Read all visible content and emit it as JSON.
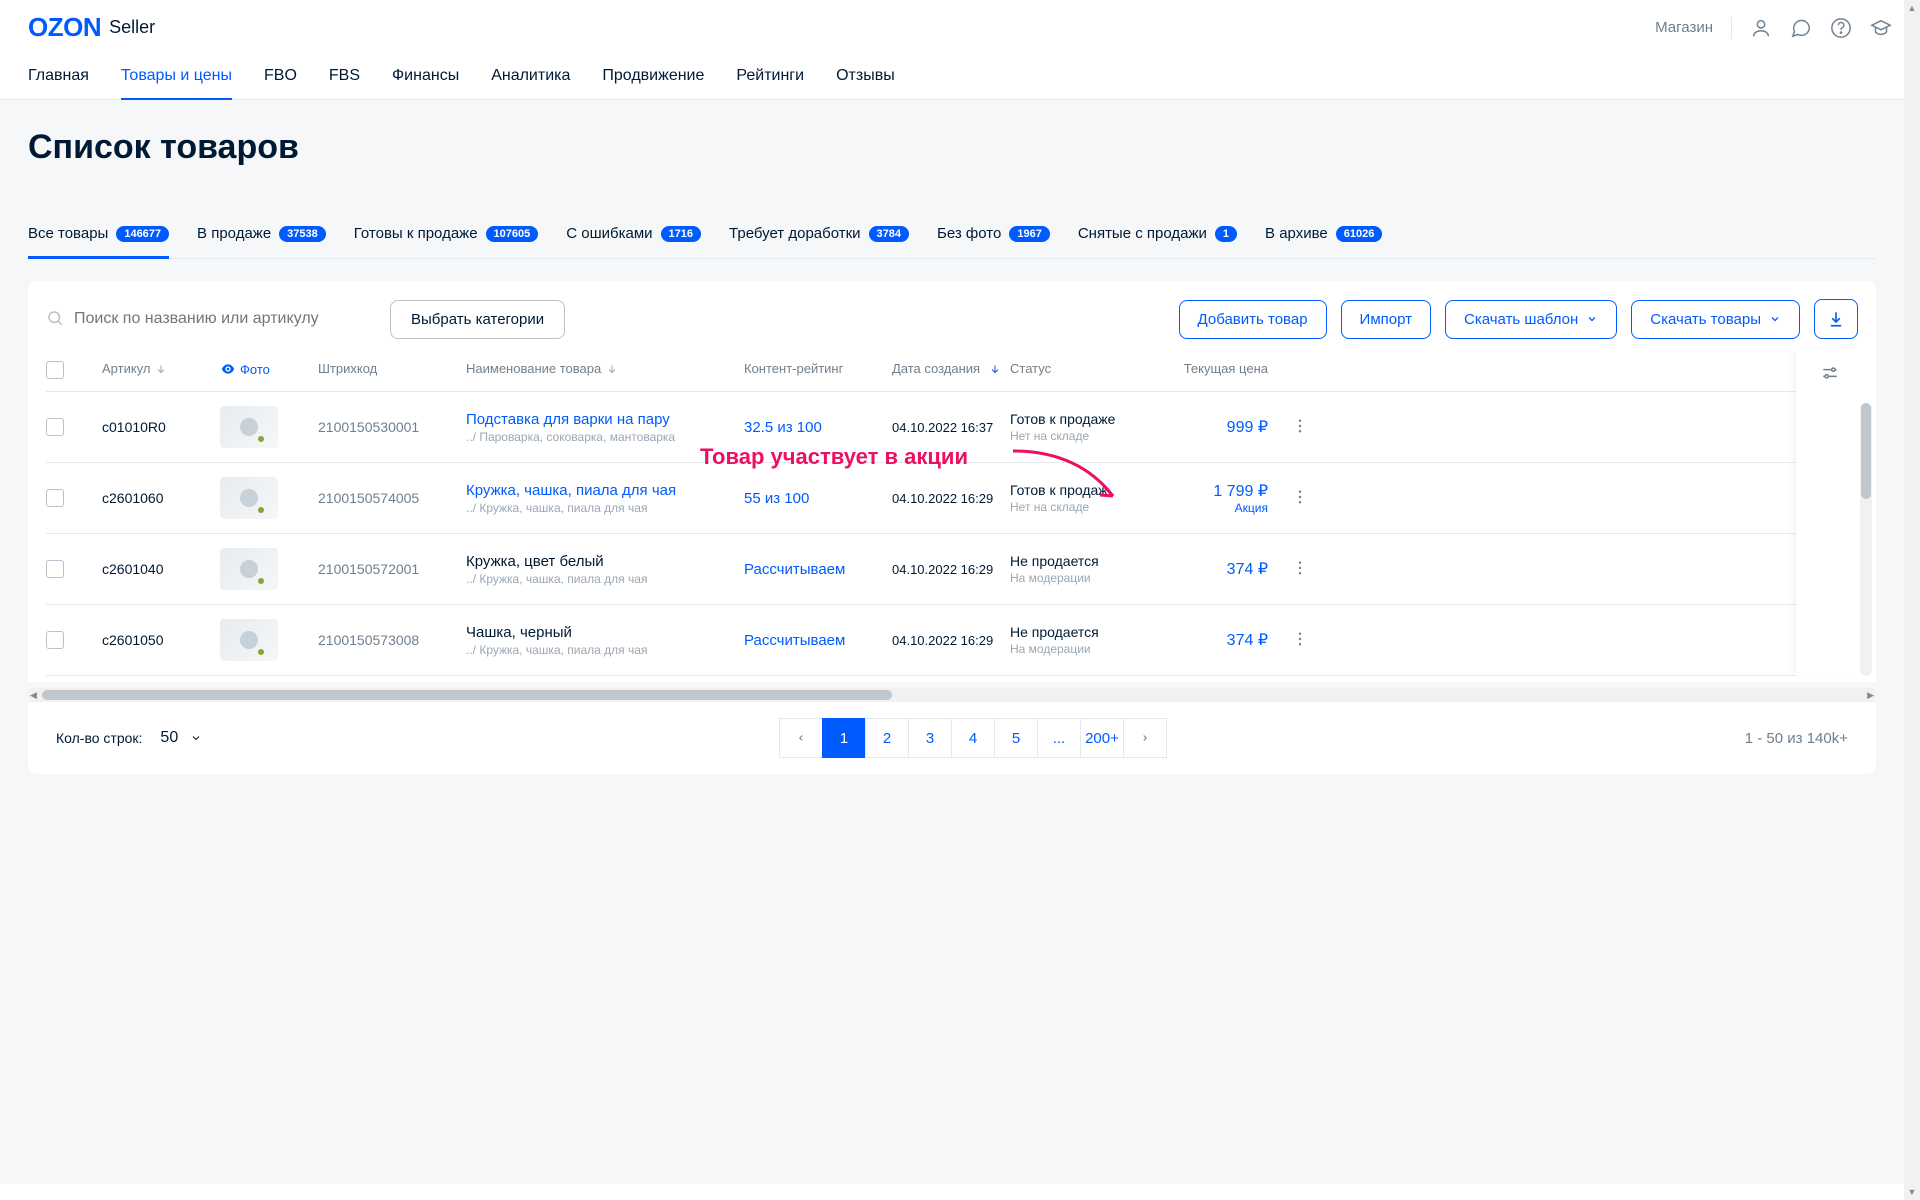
{
  "header": {
    "logo_main": "OZON",
    "logo_suffix": "Seller",
    "store_link": "Магазин"
  },
  "mainnav": {
    "items": [
      "Главная",
      "Товары и цены",
      "FBO",
      "FBS",
      "Финансы",
      "Аналитика",
      "Продвижение",
      "Рейтинги",
      "Отзывы"
    ],
    "active_index": 1
  },
  "page_title": "Список товаров",
  "filter_tabs": [
    {
      "label": "Все товары",
      "count": "146677",
      "active": true
    },
    {
      "label": "В продаже",
      "count": "37538"
    },
    {
      "label": "Готовы к продаже",
      "count": "107605"
    },
    {
      "label": "С ошибками",
      "count": "1716"
    },
    {
      "label": "Требует доработки",
      "count": "3784"
    },
    {
      "label": "Без фото",
      "count": "1967"
    },
    {
      "label": "Снятые с продажи",
      "count": "1"
    },
    {
      "label": "В архиве",
      "count": "61026"
    }
  ],
  "toolbar": {
    "search_placeholder": "Поиск по названию или артикулу",
    "categories": "Выбрать категории",
    "add": "Добавить товар",
    "import": "Импорт",
    "download_template": "Скачать шаблон",
    "download_products": "Скачать товары"
  },
  "columns": {
    "article": "Артикул",
    "photo": "Фото",
    "barcode": "Штрихкод",
    "name": "Наименование товара",
    "rating": "Контент-рейтинг",
    "date": "Дата создания",
    "status": "Статус",
    "price": "Текущая цена"
  },
  "rows": [
    {
      "article": "c01010R0",
      "barcode": "2100150530001",
      "name": "Подставка для варки на пару",
      "breadcrumb": "../ Пароварка, соковарка, мантоварка",
      "link": true,
      "rating": "32.5 из 100",
      "date": "04.10.2022 16:37",
      "status": "Готов к продаже",
      "status_sub": "Нет на складе",
      "price": "999 ₽",
      "promo": false
    },
    {
      "article": "c2601060",
      "barcode": "2100150574005",
      "name": "Кружка, чашка, пиала для чая",
      "breadcrumb": "../ Кружка, чашка, пиала для чая",
      "link": true,
      "rating": "55 из 100",
      "date": "04.10.2022 16:29",
      "status": "Готов к продаж",
      "status_sub": "Нет на складе",
      "price": "1 799 ₽",
      "promo": true,
      "promo_label": "Акция"
    },
    {
      "article": "c2601040",
      "barcode": "2100150572001",
      "name": "Кружка, цвет белый",
      "breadcrumb": "../ Кружка, чашка, пиала для чая",
      "link": false,
      "rating": "Рассчитываем",
      "date": "04.10.2022 16:29",
      "status": "Не продается",
      "status_sub": "На модерации",
      "price": "374 ₽",
      "promo": false
    },
    {
      "article": "c2601050",
      "barcode": "2100150573008",
      "name": "Чашка, черный",
      "breadcrumb": "../ Кружка, чашка, пиала для чая",
      "link": false,
      "rating": "Рассчитываем",
      "date": "04.10.2022 16:29",
      "status": "Не продается",
      "status_sub": "На модерации",
      "price": "374 ₽",
      "promo": false
    }
  ],
  "annotation": "Товар участвует в акции",
  "pagination": {
    "rows_label": "Кол-во строк:",
    "rows_value": "50",
    "pages": [
      "1",
      "2",
      "3",
      "4",
      "5",
      "...",
      "200+"
    ],
    "active_index": 0,
    "range": "1 - 50 из 140k+"
  }
}
